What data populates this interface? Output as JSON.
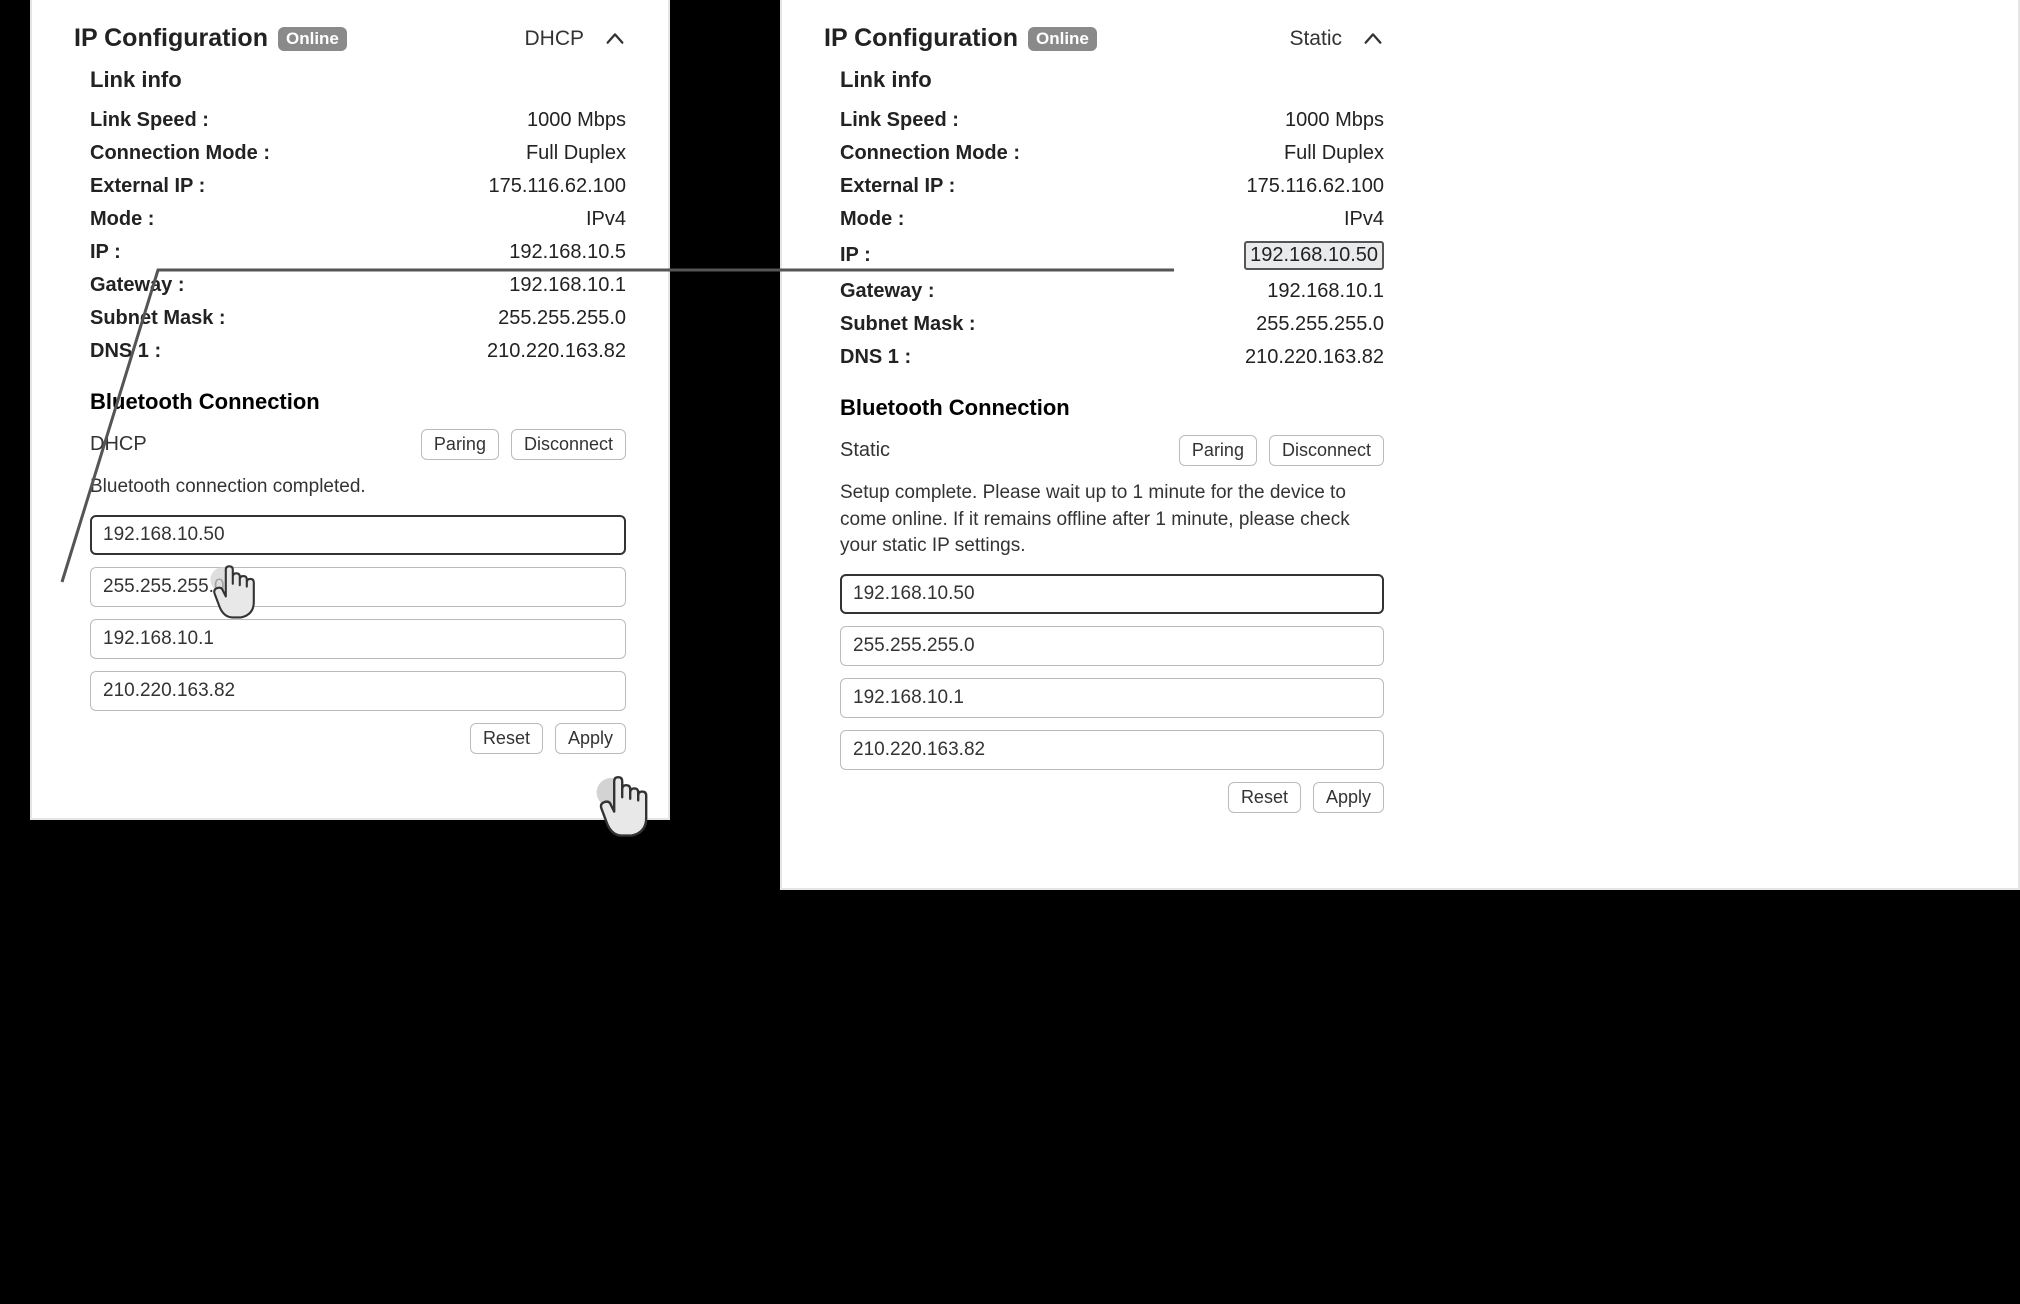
{
  "left": {
    "title": "IP Configuration",
    "badge": "Online",
    "mode": "DHCP",
    "link_info_heading": "Link info",
    "rows": {
      "link_speed_label": "Link Speed :",
      "link_speed_value": "1000 Mbps",
      "conn_mode_label": "Connection Mode :",
      "conn_mode_value": "Full Duplex",
      "ext_ip_label": "External IP :",
      "ext_ip_value": "175.116.62.100",
      "mode_label": "Mode :",
      "mode_value": "IPv4",
      "ip_label": "IP :",
      "ip_value": "192.168.10.5",
      "gateway_label": "Gateway :",
      "gateway_value": "192.168.10.1",
      "subnet_label": "Subnet Mask :",
      "subnet_value": "255.255.255.0",
      "dns1_label": "DNS 1 :",
      "dns1_value": "210.220.163.82"
    },
    "bt_heading": "Bluetooth Connection",
    "bt_mode": "DHCP",
    "buttons": {
      "paring": "Paring",
      "disconnect": "Disconnect"
    },
    "status": "Bluetooth connection completed.",
    "inputs": {
      "ip": "192.168.10.50",
      "subnet": "255.255.255.0",
      "gateway": "192.168.10.1",
      "dns": "210.220.163.82"
    },
    "bottom": {
      "reset": "Reset",
      "apply": "Apply"
    }
  },
  "right": {
    "title": "IP Configuration",
    "badge": "Online",
    "mode": "Static",
    "link_info_heading": "Link info",
    "rows": {
      "link_speed_label": "Link Speed :",
      "link_speed_value": "1000 Mbps",
      "conn_mode_label": "Connection Mode :",
      "conn_mode_value": "Full Duplex",
      "ext_ip_label": "External IP :",
      "ext_ip_value": "175.116.62.100",
      "mode_label": "Mode :",
      "mode_value": "IPv4",
      "ip_label": "IP :",
      "ip_value": "192.168.10.50",
      "gateway_label": "Gateway :",
      "gateway_value": "192.168.10.1",
      "subnet_label": "Subnet Mask :",
      "subnet_value": "255.255.255.0",
      "dns1_label": "DNS 1 :",
      "dns1_value": "210.220.163.82"
    },
    "bt_heading": "Bluetooth Connection",
    "bt_mode": "Static",
    "buttons": {
      "paring": "Paring",
      "disconnect": "Disconnect"
    },
    "status": "Setup complete. Please wait up to 1 minute for the device to come online. If it remains offline after 1 minute, please check your static IP settings.",
    "inputs": {
      "ip": "192.168.10.50",
      "subnet": "255.255.255.0",
      "gateway": "192.168.10.1",
      "dns": "210.220.163.82"
    },
    "bottom": {
      "reset": "Reset",
      "apply": "Apply"
    }
  }
}
